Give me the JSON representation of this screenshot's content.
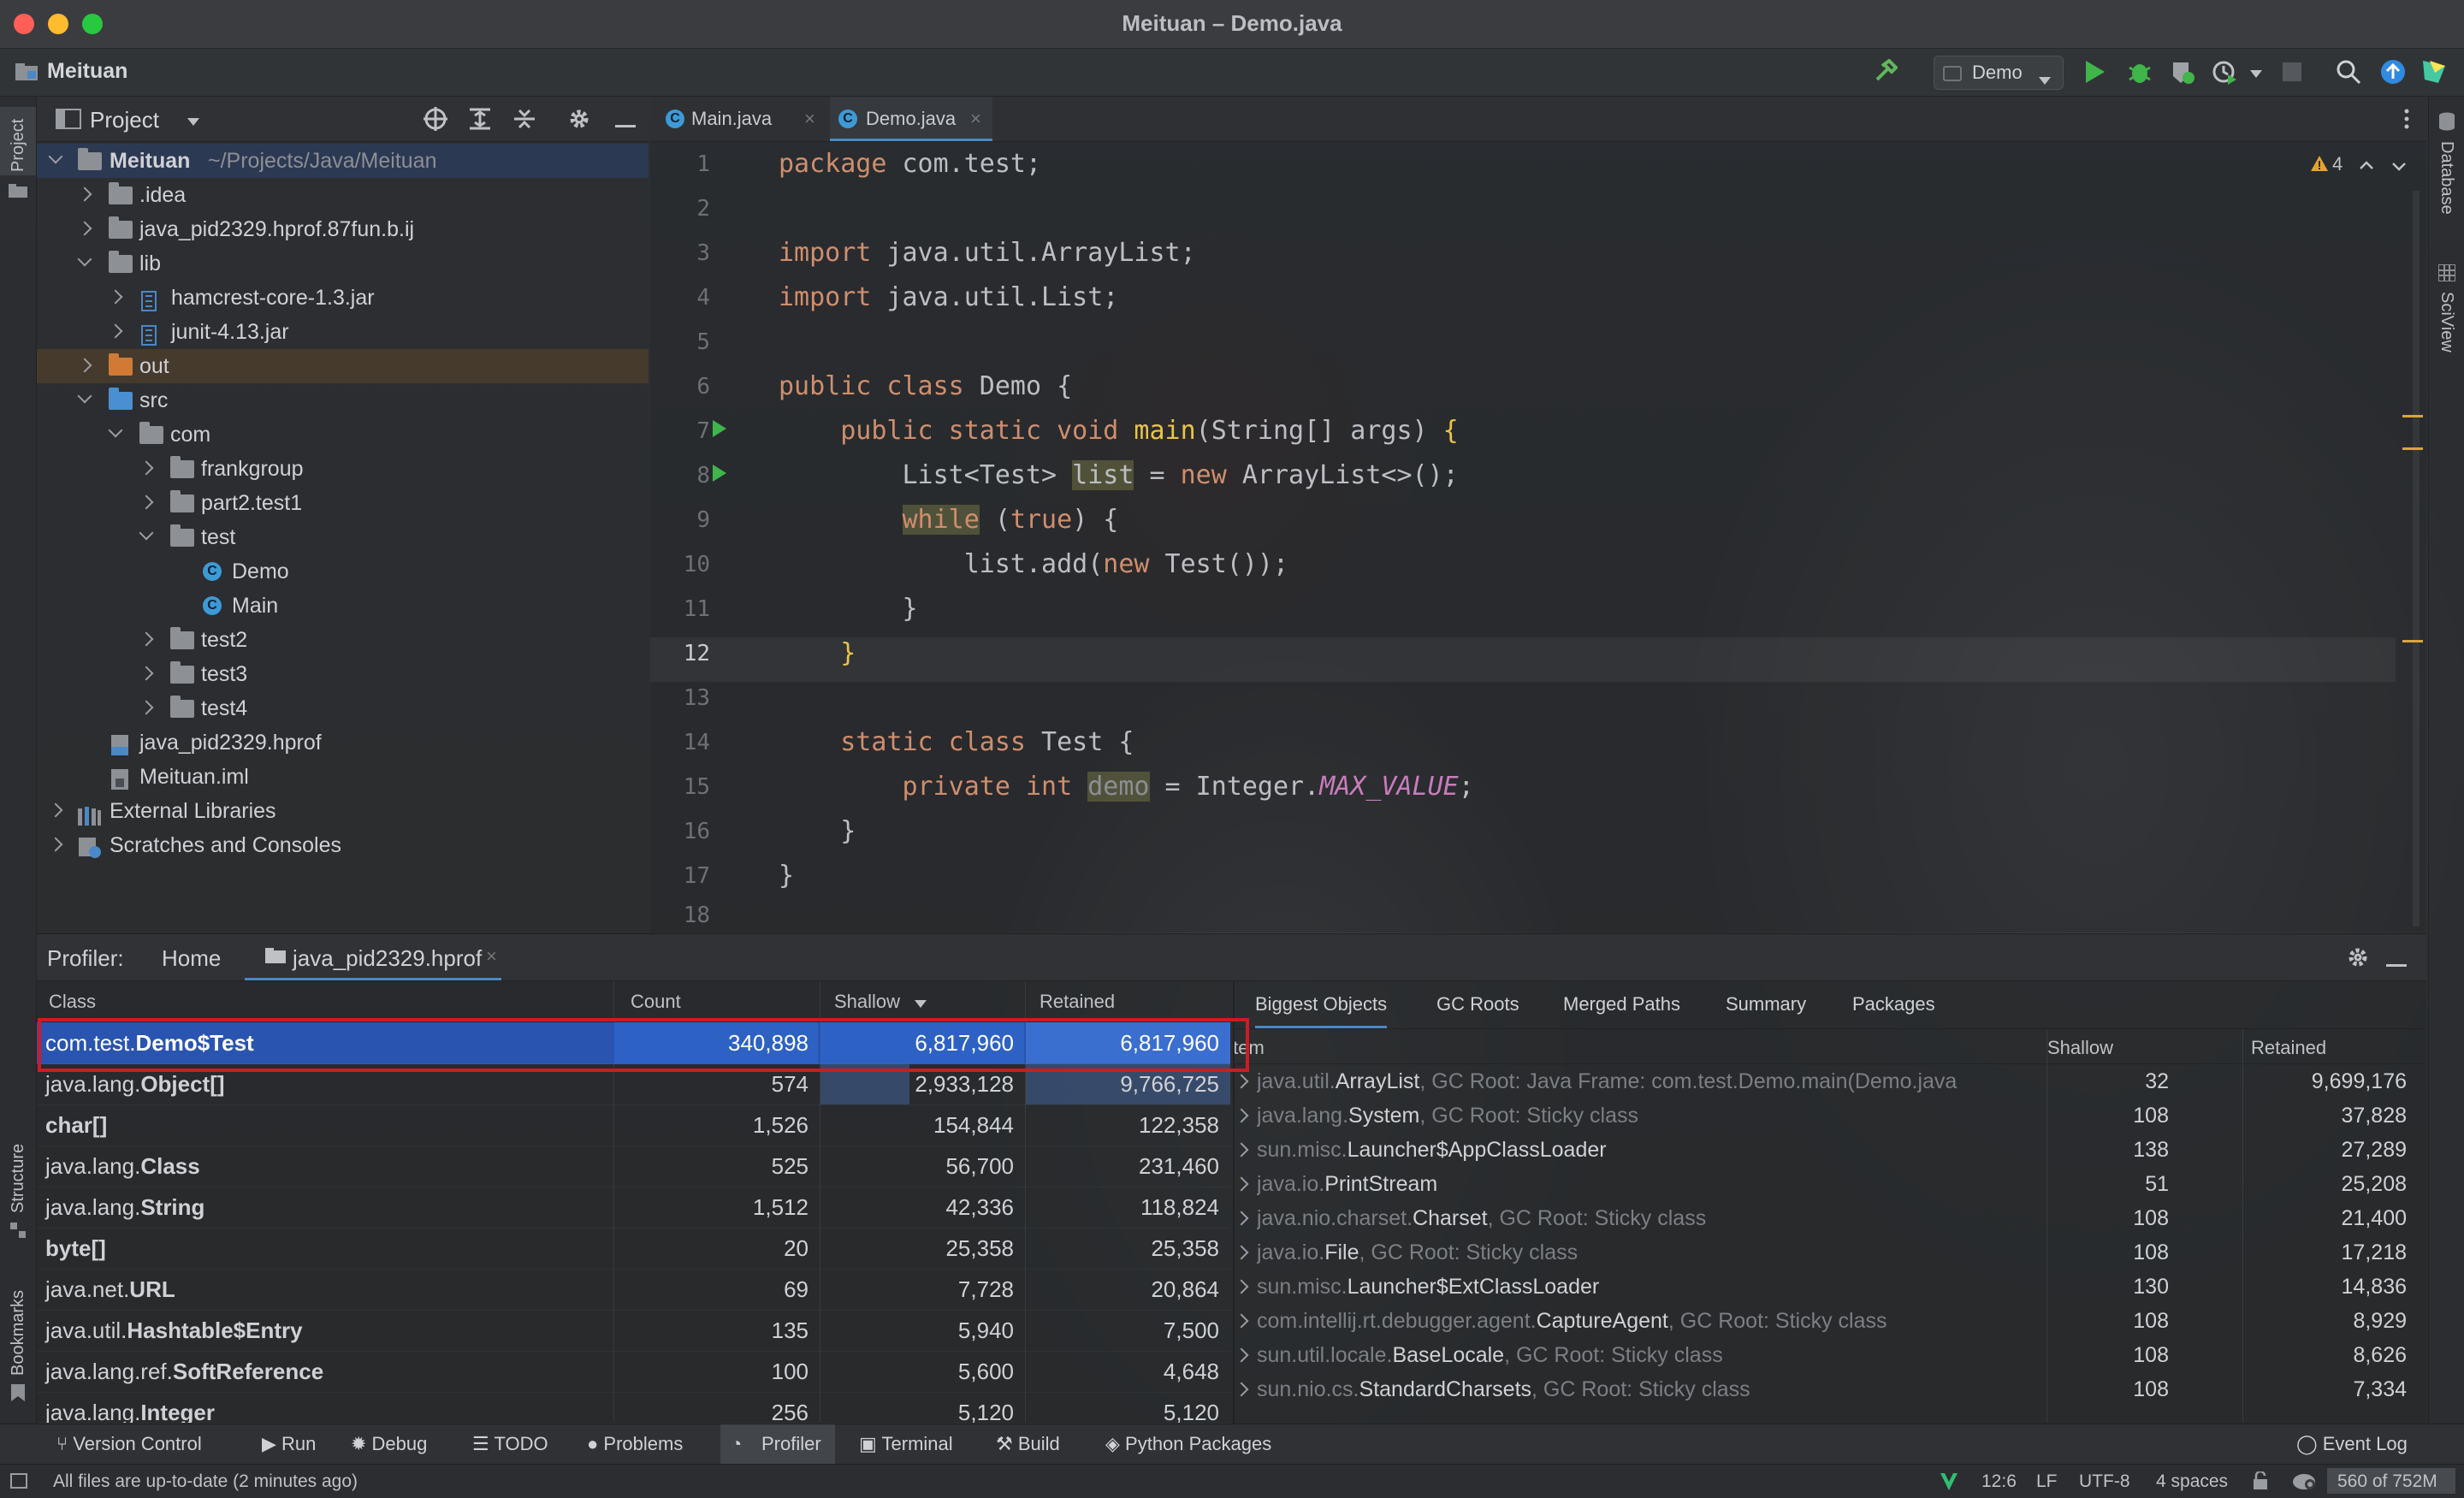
{
  "window": {
    "title": "Meituan – Demo.java"
  },
  "navbar": {
    "project": "Meituan",
    "run_config": "Demo"
  },
  "left_strip": {
    "project_label": "Project",
    "structure_label": "Structure",
    "bookmarks_label": "Bookmarks"
  },
  "right_strip": {
    "database_label": "Database",
    "sciview_label": "SciView"
  },
  "project_panel": {
    "title": "Project",
    "tree": [
      {
        "label": "Meituan",
        "hint": "~/Projects/Java/Meituan"
      },
      {
        "label": ".idea"
      },
      {
        "label": "java_pid2329.hprof.87fun.b.ij"
      },
      {
        "label": "lib"
      },
      {
        "label": "hamcrest-core-1.3.jar"
      },
      {
        "label": "junit-4.13.jar"
      },
      {
        "label": "out"
      },
      {
        "label": "src"
      },
      {
        "label": "com"
      },
      {
        "label": "frankgroup"
      },
      {
        "label": "part2.test1"
      },
      {
        "label": "test"
      },
      {
        "label": "Demo"
      },
      {
        "label": "Main"
      },
      {
        "label": "test2"
      },
      {
        "label": "test3"
      },
      {
        "label": "test4"
      },
      {
        "label": "java_pid2329.hprof"
      },
      {
        "label": "Meituan.iml"
      },
      {
        "label": "External Libraries"
      },
      {
        "label": "Scratches and Consoles"
      }
    ]
  },
  "editor": {
    "tabs": [
      {
        "label": "Main.java"
      },
      {
        "label": "Demo.java"
      }
    ],
    "warnings": "4",
    "line_numbers": [
      "1",
      "2",
      "3",
      "4",
      "5",
      "6",
      "7",
      "8",
      "9",
      "10",
      "11",
      "12",
      "13",
      "14",
      "15",
      "16",
      "17",
      "18"
    ]
  },
  "profiler": {
    "label": "Profiler:",
    "home": "Home",
    "file_tab": "java_pid2329.hprof",
    "columns": {
      "class": "Class",
      "count": "Count",
      "shallow": "Shallow",
      "retained": "Retained"
    },
    "rows": [
      {
        "pkg": "com.test.",
        "name": "Demo$Test",
        "count": "340,898",
        "shallow": "6,817,960",
        "retained": "6,817,960"
      },
      {
        "pkg": "java.lang.",
        "name": "Object[]",
        "count": "574",
        "shallow": "2,933,128",
        "retained": "9,766,725"
      },
      {
        "pkg": "",
        "name": "char[]",
        "count": "1,526",
        "shallow": "154,844",
        "retained": "122,358"
      },
      {
        "pkg": "java.lang.",
        "name": "Class",
        "count": "525",
        "shallow": "56,700",
        "retained": "231,460"
      },
      {
        "pkg": "java.lang.",
        "name": "String",
        "count": "1,512",
        "shallow": "42,336",
        "retained": "118,824"
      },
      {
        "pkg": "",
        "name": "byte[]",
        "count": "20",
        "shallow": "25,358",
        "retained": "25,358"
      },
      {
        "pkg": "java.net.",
        "name": "URL",
        "count": "69",
        "shallow": "7,728",
        "retained": "20,864"
      },
      {
        "pkg": "java.util.",
        "name": "Hashtable$Entry",
        "count": "135",
        "shallow": "5,940",
        "retained": "7,500"
      },
      {
        "pkg": "java.lang.ref.",
        "name": "SoftReference",
        "count": "100",
        "shallow": "5,600",
        "retained": "4,648"
      },
      {
        "pkg": "java.lang.",
        "name": "Integer",
        "count": "256",
        "shallow": "5,120",
        "retained": "5,120"
      }
    ],
    "right_tabs": [
      "Biggest Objects",
      "GC Roots",
      "Merged Paths",
      "Summary",
      "Packages"
    ],
    "right_columns": {
      "item": "Item",
      "shallow": "Shallow",
      "retained": "Retained"
    },
    "biggest": [
      {
        "pkg": "java.util.",
        "name": "ArrayList",
        "root": ", GC Root: Java Frame: com.test.Demo.main(Demo.java",
        "shallow": "32",
        "retained": "9,699,176"
      },
      {
        "pkg": "java.lang.",
        "name": "System",
        "root": ", GC Root: Sticky class",
        "shallow": "108",
        "retained": "37,828"
      },
      {
        "pkg": "sun.misc.",
        "name": "Launcher$AppClassLoader",
        "root": "",
        "shallow": "138",
        "retained": "27,289"
      },
      {
        "pkg": "java.io.",
        "name": "PrintStream",
        "root": "",
        "shallow": "51",
        "retained": "25,208"
      },
      {
        "pkg": "java.nio.charset.",
        "name": "Charset",
        "root": ", GC Root: Sticky class",
        "shallow": "108",
        "retained": "21,400"
      },
      {
        "pkg": "java.io.",
        "name": "File",
        "root": ", GC Root: Sticky class",
        "shallow": "108",
        "retained": "17,218"
      },
      {
        "pkg": "sun.misc.",
        "name": "Launcher$ExtClassLoader",
        "root": "",
        "shallow": "130",
        "retained": "14,836"
      },
      {
        "pkg": "com.intellij.rt.debugger.agent.",
        "name": "CaptureAgent",
        "root": ", GC Root: Sticky class",
        "shallow": "108",
        "retained": "8,929"
      },
      {
        "pkg": "sun.util.locale.",
        "name": "BaseLocale",
        "root": ", GC Root: Sticky class",
        "shallow": "108",
        "retained": "8,626"
      },
      {
        "pkg": "sun.nio.cs.",
        "name": "StandardCharsets",
        "root": ", GC Root: Sticky class",
        "shallow": "108",
        "retained": "7,334"
      }
    ]
  },
  "tool_windows": [
    "Version Control",
    "Run",
    "Debug",
    "TODO",
    "Problems",
    "Profiler",
    "Terminal",
    "Build",
    "Python Packages",
    "Event Log"
  ],
  "status": {
    "message": "All files are up-to-date (2 minutes ago)",
    "position": "12:6",
    "line_sep": "LF",
    "encoding": "UTF-8",
    "indent": "4 spaces",
    "memory": "560 of 752M"
  }
}
